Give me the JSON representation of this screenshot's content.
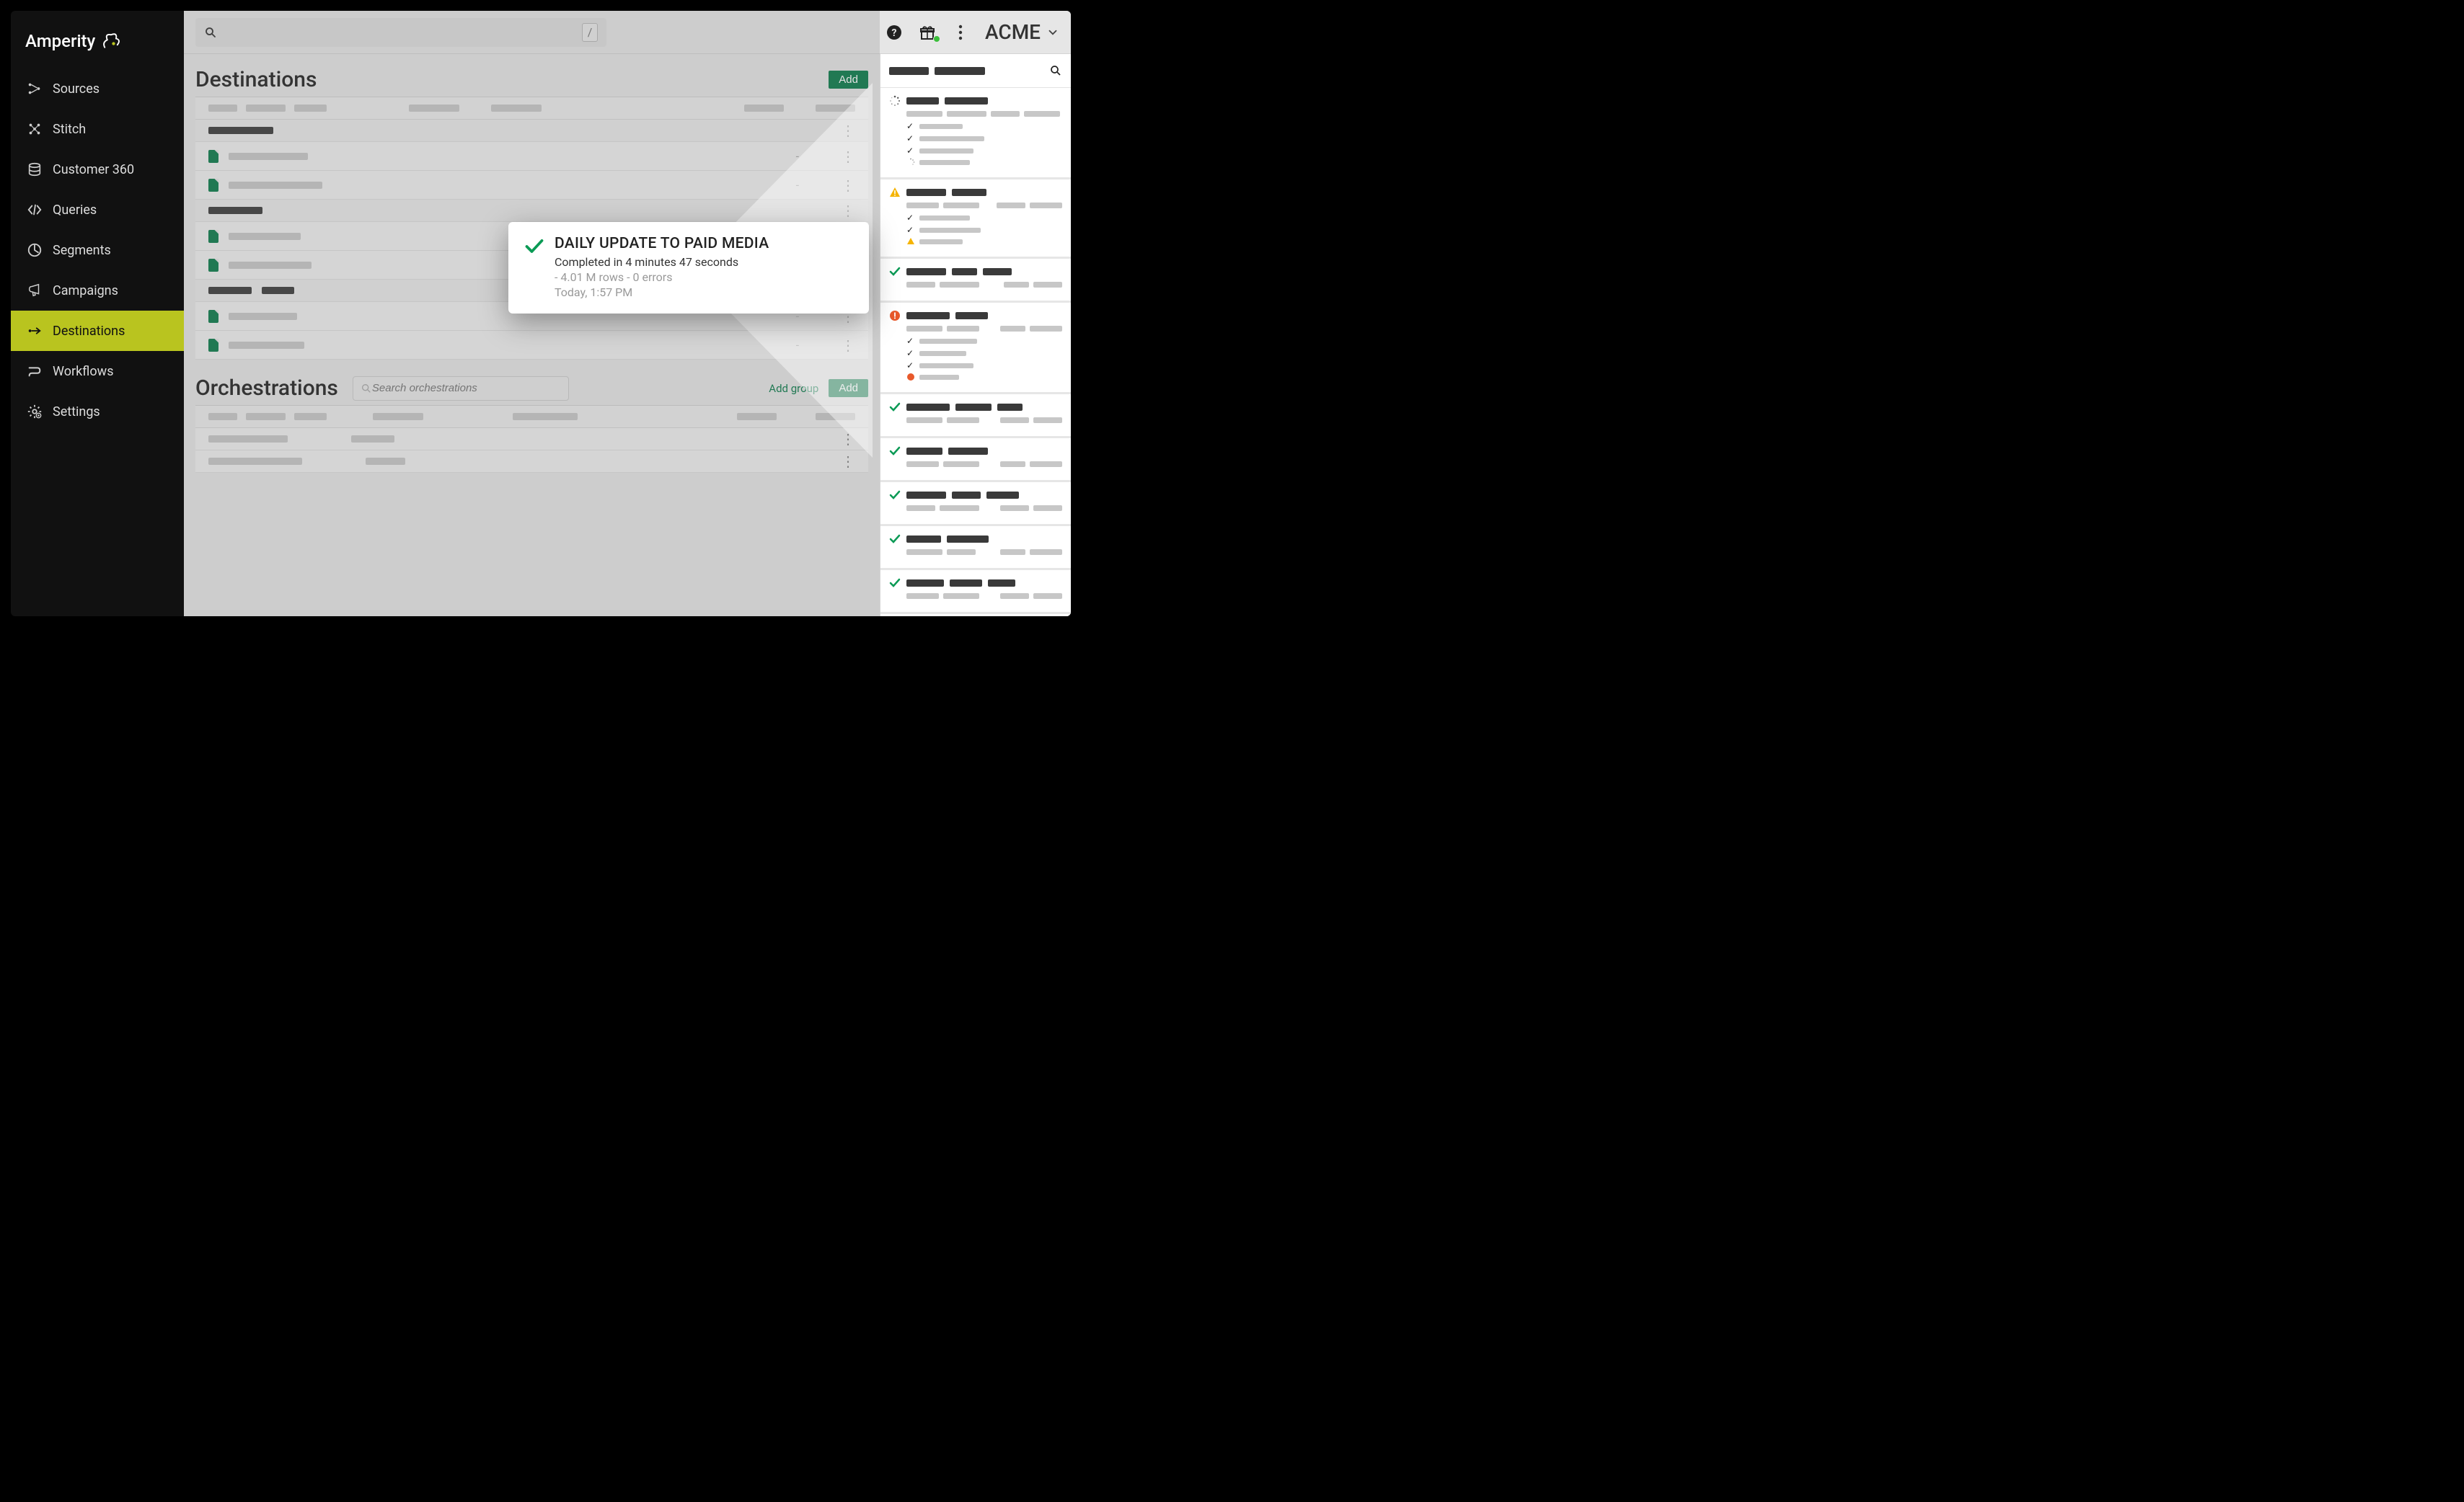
{
  "brand": {
    "name": "Amperity"
  },
  "nav": {
    "items": [
      {
        "label": "Sources"
      },
      {
        "label": "Stitch"
      },
      {
        "label": "Customer 360"
      },
      {
        "label": "Queries"
      },
      {
        "label": "Segments"
      },
      {
        "label": "Campaigns"
      },
      {
        "label": "Destinations",
        "active": true
      },
      {
        "label": "Workflows"
      },
      {
        "label": "Settings"
      }
    ]
  },
  "topbar": {
    "search_placeholder": "",
    "slash": "/",
    "tenant": "ACME"
  },
  "destinations": {
    "title": "Destinations",
    "add_label": "Add"
  },
  "orchestrations": {
    "title": "Orchestrations",
    "search_placeholder": "Search orchestrations",
    "add_group_label": "Add group",
    "add_label": "Add"
  },
  "callout": {
    "title": "DAILY UPDATE TO PAID MEDIA",
    "completed": "Completed in 4 minutes 47 seconds",
    "meta": "- 4.01 M rows - 0 errors",
    "timestamp": "Today, 1:57 PM"
  }
}
